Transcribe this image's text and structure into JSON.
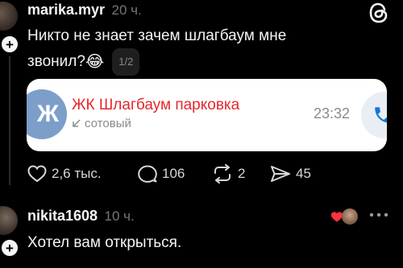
{
  "post1": {
    "username": "marika.myr",
    "time": "20 ч.",
    "text_line1": "Никто не знает зачем шлагбаум мне",
    "text_line2": "звонил?",
    "emoji": "😂",
    "page_indicator": "1/2",
    "call_card": {
      "avatar_letters": "Ж",
      "contact_name": "ЖК Шлагбаум парковка",
      "call_type": "сотовый",
      "call_time": "23:32"
    },
    "actions": {
      "likes": "2,6 тыс.",
      "comments": "106",
      "reposts": "2",
      "shares": "45"
    }
  },
  "post2": {
    "username": "nikita1608",
    "time": "10 ч.",
    "text": "Хотел вам открыться."
  },
  "icons": {
    "follow": "+",
    "app_logo": "threads-icon"
  },
  "colors": {
    "background": "#000000",
    "contact_name": "#e8262c",
    "heart": "#ff3040",
    "card_avatar": "#7d9ec8",
    "call_button": "#1976d2"
  }
}
